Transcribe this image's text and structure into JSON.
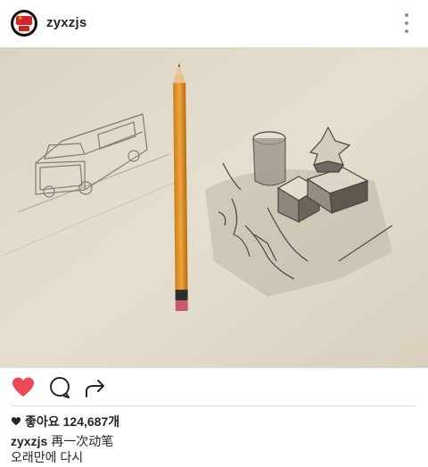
{
  "header": {
    "username": "zyxzjs",
    "more_icon": "more-vertical-icon"
  },
  "photo": {
    "description_icon": "sketch-photo"
  },
  "actions": {
    "like_icon": "heart-filled-icon",
    "comment_icon": "comment-bubble-icon",
    "share_icon": "share-arrow-icon",
    "like_color": "#ed4956"
  },
  "likes": {
    "label": "좋아요",
    "count": "124,687개"
  },
  "caption": {
    "username": "zyxzjs",
    "line1": "再一次动笔",
    "line2": "오래만에 다시"
  }
}
